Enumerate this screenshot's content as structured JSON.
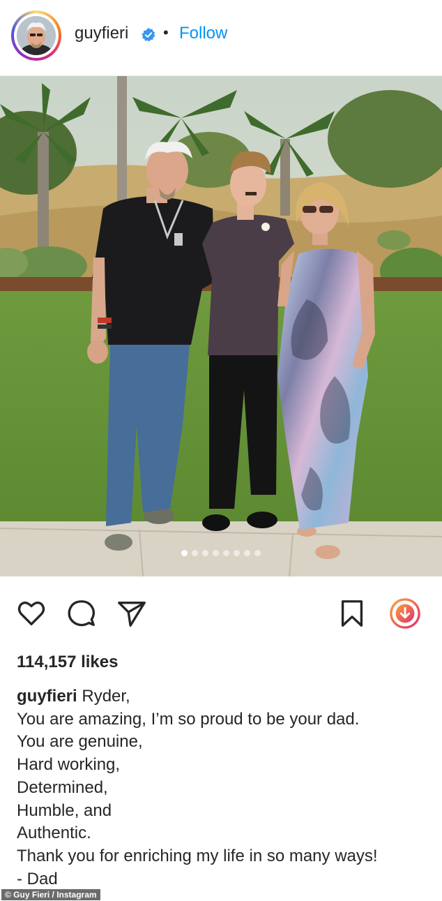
{
  "post": {
    "username": "guyfieri",
    "follow_label": "Follow",
    "separator": "•",
    "likes": "114,157 likes",
    "carousel": {
      "count": 8,
      "active_index": 0
    },
    "caption": {
      "username": "guyfieri",
      "first_line": "Ryder,",
      "lines": [
        "You are amazing, I’m so proud to be your dad.",
        "You are genuine,",
        "Hard working,",
        "Determined,",
        "Humble, and",
        "Authentic.",
        "Thank you for enriching my life in so many ways!",
        "- Dad"
      ]
    },
    "icons": {
      "verified": "verified-badge-icon",
      "like": "heart-icon",
      "comment": "comment-bubble-icon",
      "share": "paper-plane-icon",
      "save": "bookmark-icon",
      "download": "download-circle-icon"
    }
  },
  "credit": "© Guy Fieri / Instagram",
  "colors": {
    "link_blue": "#0095f6",
    "verified_blue": "#3897f0",
    "text": "#262626"
  }
}
